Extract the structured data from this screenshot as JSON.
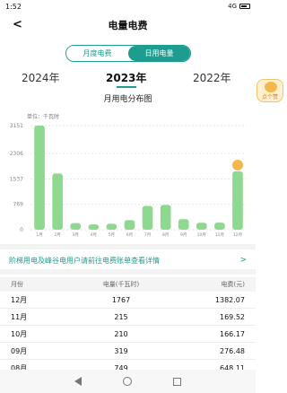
{
  "status_bar": {
    "time": "1:52",
    "signal_text": "4G"
  },
  "header": {
    "title": "电量电费",
    "back_icon": "chevron-left-icon"
  },
  "segments": [
    {
      "label": "月度电费",
      "active": true
    },
    {
      "label": "日用电量",
      "active": false
    }
  ],
  "years": [
    "2024年",
    "2023年",
    "2022年"
  ],
  "selected_year": "2023年",
  "mascot_text": "点个赞",
  "chart_title": "月用电分布图",
  "unit_label": "单位：千瓦时",
  "chart_data": {
    "type": "bar",
    "categories": [
      "1月",
      "2月",
      "3月",
      "4月",
      "5月",
      "6月",
      "7月",
      "8月",
      "9月",
      "10月",
      "11月",
      "12月"
    ],
    "values": [
      3151,
      1700,
      200,
      160,
      180,
      290,
      720,
      749,
      319,
      210,
      215,
      1767
    ],
    "y_ticks": [
      "3151",
      "2306",
      "1537",
      "769",
      "0"
    ],
    "ylim": [
      0,
      3151
    ],
    "colors": {
      "bar": "#8fd88f"
    }
  },
  "notice": {
    "text": "阶梯用电及峰谷电用户请前往电费账单查看详情",
    "arrow": ">"
  },
  "table": {
    "headers": [
      "月份",
      "电量(千瓦时)",
      "电费(元)"
    ],
    "rows": [
      {
        "month": "12月",
        "kwh": "1767",
        "fee": "1382.07"
      },
      {
        "month": "11月",
        "kwh": "215",
        "fee": "169.52"
      },
      {
        "month": "10月",
        "kwh": "210",
        "fee": "166.17"
      },
      {
        "month": "09月",
        "kwh": "319",
        "fee": "276.48"
      },
      {
        "month": "08月",
        "kwh": "749",
        "fee": "648.11"
      }
    ]
  }
}
